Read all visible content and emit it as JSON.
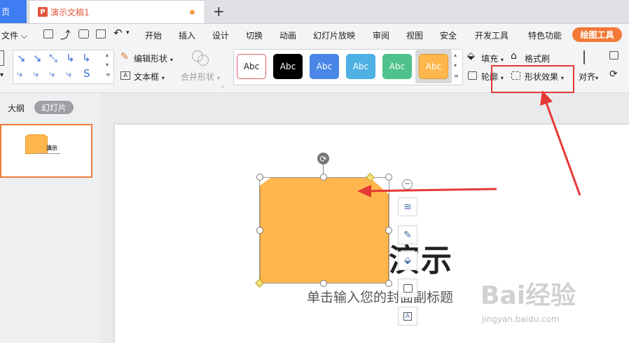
{
  "tabs": {
    "home": "页",
    "document": "演示文稿1",
    "add": "+"
  },
  "menu": {
    "file": "文件",
    "items": [
      "开始",
      "插入",
      "设计",
      "切换",
      "动画",
      "幻灯片放映",
      "审阅",
      "视图",
      "安全",
      "开发工具",
      "特色功能"
    ],
    "active_tab": "绘图工具"
  },
  "ribbon": {
    "edit_shape": "编辑形状",
    "text_box": "文本框",
    "merge_shape": "合并形状",
    "style_label": "Abc",
    "fill": "填充",
    "format_painter": "格式刷",
    "outline": "轮廓",
    "shape_effects": "形状效果",
    "align": "对齐"
  },
  "styles": [
    {
      "bg": "#ffffff",
      "border": "#e05a6a",
      "text": "#222222"
    },
    {
      "bg": "#000000",
      "border": "#000000",
      "text": "#ffffff"
    },
    {
      "bg": "#4a86e8",
      "border": "#4a86e8",
      "text": "#ffffff"
    },
    {
      "bg": "#4fb0e3",
      "border": "#4fb0e3",
      "text": "#ffffff"
    },
    {
      "bg": "#4ec28a",
      "border": "#4ec28a",
      "text": "#ffffff"
    },
    {
      "bg": "#ffb74d",
      "border": "#e39a2c",
      "text": "#ffffff"
    }
  ],
  "sidebar": {
    "outline_tab": "大纲",
    "slides_tab": "幻灯片",
    "thumb_title": "演示"
  },
  "slide": {
    "title": "演示",
    "subtitle": "单击输入您的封面副标题"
  },
  "watermark": {
    "brand": "Bai经验",
    "url": "jingyan.baidu.com"
  },
  "colors": {
    "accent": "#f27937",
    "shape_fill": "#ffb74d",
    "highlight": "#e53935"
  }
}
